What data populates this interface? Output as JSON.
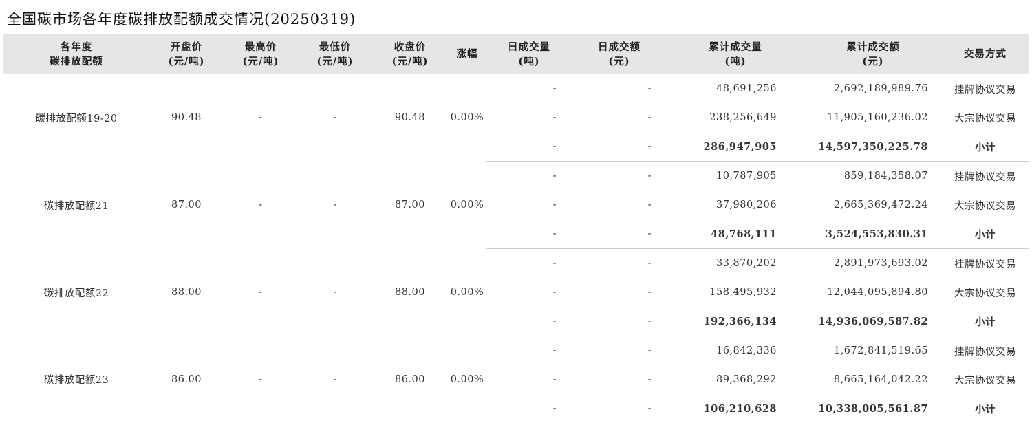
{
  "title": "全国碳市场各年度碳排放配额成交情况(20250319)",
  "headers": [
    {
      "line1": "各年度",
      "line2": "碳排放配额"
    },
    {
      "line1": "开盘价",
      "line2": "(元/吨)"
    },
    {
      "line1": "最高价",
      "line2": "(元/吨)"
    },
    {
      "line1": "最低价",
      "line2": "(元/吨)"
    },
    {
      "line1": "收盘价",
      "line2": "(元/吨)"
    },
    {
      "line1": "涨幅",
      "line2": ""
    },
    {
      "line1": "日成交量",
      "line2": "(吨)"
    },
    {
      "line1": "日成交额",
      "line2": "(元)"
    },
    {
      "line1": "累计成交量",
      "line2": "(吨)"
    },
    {
      "line1": "累计成交额",
      "line2": "(元)"
    },
    {
      "line1": "交易方式",
      "line2": ""
    }
  ],
  "groups": [
    {
      "name": "碳排放配额19-20",
      "open": "90.48",
      "high": "-",
      "low": "-",
      "close": "90.48",
      "change": "0.00%",
      "rows": [
        {
          "daily_vol": "-",
          "daily_amt": "-",
          "cum_vol": "48,691,256",
          "cum_amt": "2,692,189,989.76",
          "method": "挂牌协议交易"
        },
        {
          "daily_vol": "-",
          "daily_amt": "-",
          "cum_vol": "238,256,649",
          "cum_amt": "11,905,160,236.02",
          "method": "大宗协议交易"
        },
        {
          "daily_vol": "-",
          "daily_amt": "-",
          "cum_vol": "286,947,905",
          "cum_amt": "14,597,350,225.78",
          "method": "小计"
        }
      ]
    },
    {
      "name": "碳排放配额21",
      "open": "87.00",
      "high": "-",
      "low": "-",
      "close": "87.00",
      "change": "0.00%",
      "rows": [
        {
          "daily_vol": "-",
          "daily_amt": "-",
          "cum_vol": "10,787,905",
          "cum_amt": "859,184,358.07",
          "method": "挂牌协议交易"
        },
        {
          "daily_vol": "-",
          "daily_amt": "-",
          "cum_vol": "37,980,206",
          "cum_amt": "2,665,369,472.24",
          "method": "大宗协议交易"
        },
        {
          "daily_vol": "-",
          "daily_amt": "-",
          "cum_vol": "48,768,111",
          "cum_amt": "3,524,553,830.31",
          "method": "小计"
        }
      ]
    },
    {
      "name": "碳排放配额22",
      "open": "88.00",
      "high": "-",
      "low": "-",
      "close": "88.00",
      "change": "0.00%",
      "rows": [
        {
          "daily_vol": "-",
          "daily_amt": "-",
          "cum_vol": "33,870,202",
          "cum_amt": "2,891,973,693.02",
          "method": "挂牌协议交易"
        },
        {
          "daily_vol": "-",
          "daily_amt": "-",
          "cum_vol": "158,495,932",
          "cum_amt": "12,044,095,894.80",
          "method": "大宗协议交易"
        },
        {
          "daily_vol": "-",
          "daily_amt": "-",
          "cum_vol": "192,366,134",
          "cum_amt": "14,936,069,587.82",
          "method": "小计"
        }
      ]
    },
    {
      "name": "碳排放配额23",
      "open": "86.00",
      "high": "-",
      "low": "-",
      "close": "86.00",
      "change": "0.00%",
      "rows": [
        {
          "daily_vol": "-",
          "daily_amt": "-",
          "cum_vol": "16,842,336",
          "cum_amt": "1,672,841,519.65",
          "method": "挂牌协议交易"
        },
        {
          "daily_vol": "-",
          "daily_amt": "-",
          "cum_vol": "89,368,292",
          "cum_amt": "8,665,164,042.22",
          "method": "大宗协议交易"
        },
        {
          "daily_vol": "-",
          "daily_amt": "-",
          "cum_vol": "106,210,628",
          "cum_amt": "10,338,005,561.87",
          "method": "小计"
        }
      ]
    }
  ]
}
